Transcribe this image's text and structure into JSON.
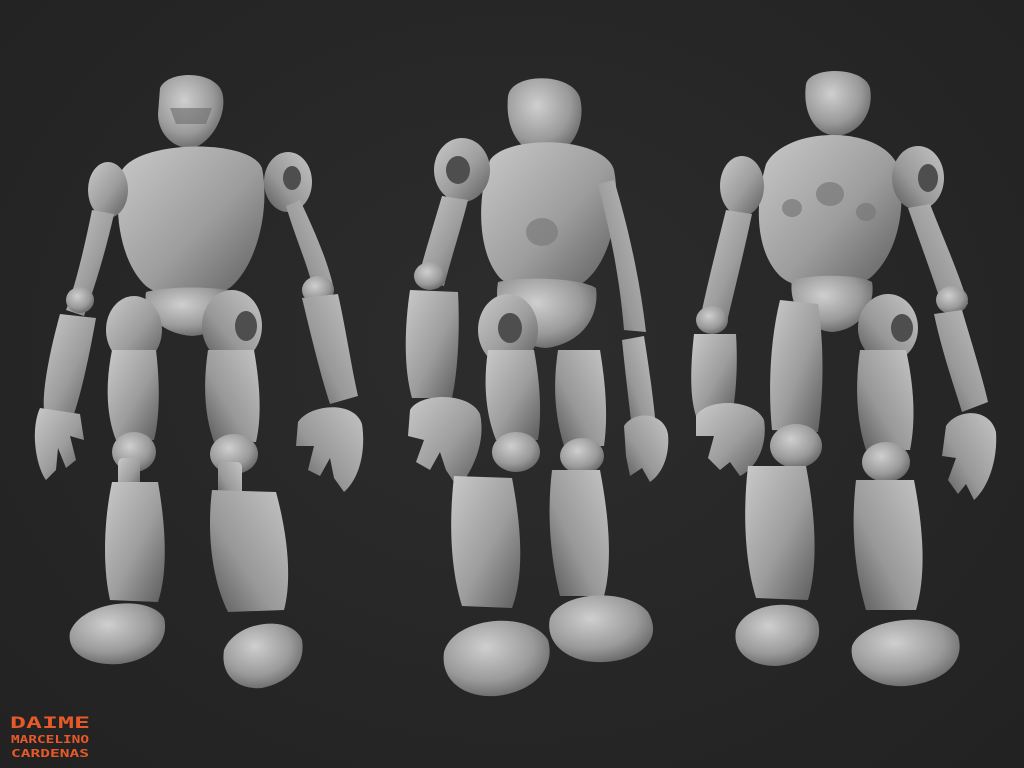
{
  "scene": {
    "background_color": "#272727",
    "clay_color": "#9a9a9a",
    "views": [
      {
        "id": "front",
        "label": ""
      },
      {
        "id": "three-quarter",
        "label": ""
      },
      {
        "id": "back",
        "label": ""
      }
    ]
  },
  "signature": {
    "color": "#e8592a",
    "line1": "DAIME",
    "line2": "MARCELINO",
    "line3": "CARDENAS"
  }
}
